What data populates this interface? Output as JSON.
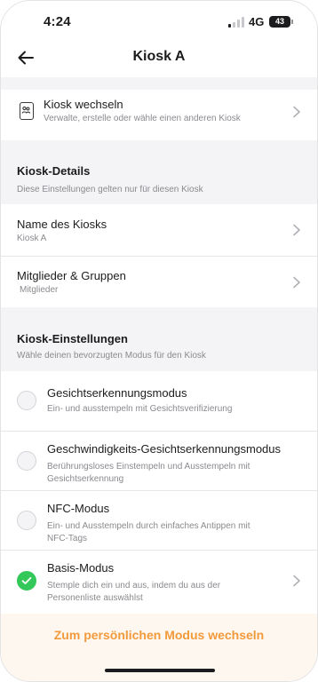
{
  "status_bar": {
    "time": "4:24",
    "network": "4G",
    "battery": "43"
  },
  "header": {
    "title": "Kiosk A"
  },
  "switch_kiosk": {
    "title": "Kiosk wechseln",
    "subtitle": "Verwalte, erstelle oder wähle einen anderen Kiosk"
  },
  "kiosk_details": {
    "heading": "Kiosk-Details",
    "description": "Diese Einstellungen gelten nur für diesen Kiosk",
    "items": [
      {
        "title": "Name des Kiosks",
        "subtitle": "Kiosk A"
      },
      {
        "title": "Mitglieder & Gruppen",
        "subtitle": "Mitglieder"
      }
    ]
  },
  "kiosk_settings": {
    "heading": "Kiosk-Einstellungen",
    "description": "Wähle deinen bevorzugten Modus für den Kiosk",
    "modes": [
      {
        "title": "Gesichtserkennungsmodus",
        "subtitle": "Ein- und ausstempeln mit Gesichtsverifizierung",
        "selected": false
      },
      {
        "title": "Geschwindigkeits-Gesichtserkennungsmodus",
        "subtitle": "Berührungsloses Einstempeln und Ausstempeln mit Gesichtserkennung",
        "selected": false
      },
      {
        "title": "NFC-Modus",
        "subtitle": "Ein- und Ausstempeln durch einfaches Antippen mit NFC-Tags",
        "selected": false
      },
      {
        "title": "Basis-Modus",
        "subtitle": "Stemple dich ein und aus, indem du aus der Personenliste auswählst",
        "selected": true
      }
    ]
  },
  "footer": {
    "button_label": "Zum persönlichen Modus wechseln"
  },
  "colors": {
    "accent": "#f29a3c",
    "selected": "#34c759",
    "section_bg": "#f4f4f6"
  }
}
